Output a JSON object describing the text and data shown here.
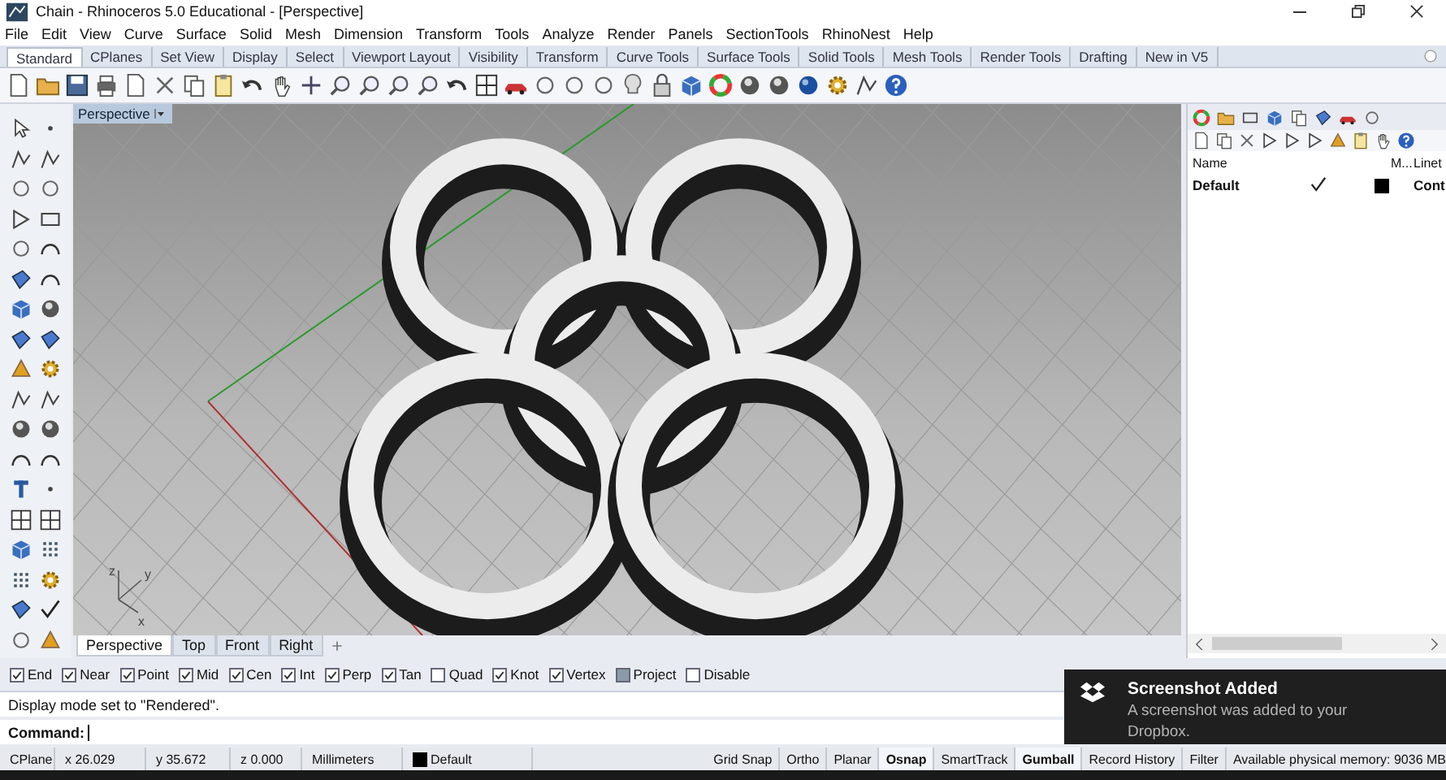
{
  "window": {
    "title": "Chain - Rhinoceros 5.0 Educational - [Perspective]"
  },
  "menu": [
    "File",
    "Edit",
    "View",
    "Curve",
    "Surface",
    "Solid",
    "Mesh",
    "Dimension",
    "Transform",
    "Tools",
    "Analyze",
    "Render",
    "Panels",
    "SectionTools",
    "RhinoNest",
    "Help"
  ],
  "toolbar_tabs": [
    {
      "label": "Standard",
      "selected": true
    },
    {
      "label": "CPlanes",
      "selected": false
    },
    {
      "label": "Set View",
      "selected": false
    },
    {
      "label": "Display",
      "selected": false
    },
    {
      "label": "Select",
      "selected": false
    },
    {
      "label": "Viewport Layout",
      "selected": false
    },
    {
      "label": "Visibility",
      "selected": false
    },
    {
      "label": "Transform",
      "selected": false
    },
    {
      "label": "Curve Tools",
      "selected": false
    },
    {
      "label": "Surface Tools",
      "selected": false
    },
    {
      "label": "Solid Tools",
      "selected": false
    },
    {
      "label": "Mesh Tools",
      "selected": false
    },
    {
      "label": "Render Tools",
      "selected": false
    },
    {
      "label": "Drafting",
      "selected": false
    },
    {
      "label": "New in V5",
      "selected": false
    }
  ],
  "viewport": {
    "title": "Perspective",
    "axis_labels": [
      "z",
      "y",
      "x"
    ]
  },
  "viewport_tabs": [
    {
      "label": "Perspective",
      "selected": true
    },
    {
      "label": "Top",
      "selected": false
    },
    {
      "label": "Front",
      "selected": false
    },
    {
      "label": "Right",
      "selected": false
    }
  ],
  "osnaps": [
    {
      "label": "End",
      "checked": true,
      "kind": "tick"
    },
    {
      "label": "Near",
      "checked": true,
      "kind": "tick"
    },
    {
      "label": "Point",
      "checked": true,
      "kind": "tick"
    },
    {
      "label": "Mid",
      "checked": true,
      "kind": "tick"
    },
    {
      "label": "Cen",
      "checked": true,
      "kind": "tick"
    },
    {
      "label": "Int",
      "checked": true,
      "kind": "tick"
    },
    {
      "label": "Perp",
      "checked": true,
      "kind": "tick"
    },
    {
      "label": "Tan",
      "checked": true,
      "kind": "tick"
    },
    {
      "label": "Quad",
      "checked": false,
      "kind": "tick"
    },
    {
      "label": "Knot",
      "checked": true,
      "kind": "tick"
    },
    {
      "label": "Vertex",
      "checked": true,
      "kind": "tick"
    },
    {
      "label": "Project",
      "checked": true,
      "kind": "fill"
    },
    {
      "label": "Disable",
      "checked": false,
      "kind": "fill"
    }
  ],
  "command_history": "Display mode set to \"Rendered\".",
  "command_prompt": "Command:",
  "status_bar": {
    "cplane": "CPlane",
    "x": "x 26.029",
    "y": "y 35.672",
    "z": "z 0.000",
    "units": "Millimeters",
    "layer": {
      "name": "Default",
      "color": "#000000"
    },
    "toggles": [
      {
        "label": "Grid Snap",
        "on": false
      },
      {
        "label": "Ortho",
        "on": false
      },
      {
        "label": "Planar",
        "on": false
      },
      {
        "label": "Osnap",
        "on": true
      },
      {
        "label": "SmartTrack",
        "on": false
      },
      {
        "label": "Gumball",
        "on": true
      },
      {
        "label": "Record History",
        "on": false
      },
      {
        "label": "Filter",
        "on": false
      }
    ],
    "memory": "Available physical memory: 9036 MB"
  },
  "layers_panel": {
    "columns": [
      "Name",
      "M...",
      "Linet"
    ],
    "rows": [
      {
        "name": "Default",
        "current": true,
        "color": "#000000",
        "linetype": "Cont"
      }
    ]
  },
  "notification": {
    "title": "Screenshot Added",
    "body": "A screenshot was added to your Dropbox."
  }
}
